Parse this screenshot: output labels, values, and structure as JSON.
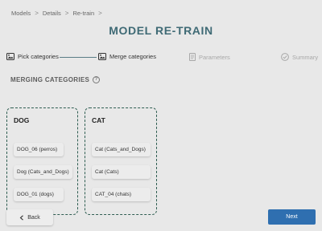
{
  "breadcrumb": {
    "items": [
      "Models",
      "Details",
      "Re-train"
    ],
    "separator": ">"
  },
  "page_title": "MODEL RE-TRAIN",
  "stepper": {
    "steps": [
      {
        "label": "Pick categories",
        "icon": "image-icon",
        "state": "active"
      },
      {
        "label": "Merge categories",
        "icon": "image-icon",
        "state": "active"
      },
      {
        "label": "Parameters",
        "icon": "document-icon",
        "state": "inactive"
      },
      {
        "label": "Summary",
        "icon": "check-circle-icon",
        "state": "inactive"
      }
    ]
  },
  "section": {
    "title": "MERGING CATEGORIES",
    "help_icon": "?"
  },
  "categories": [
    {
      "name": "DOG",
      "items": [
        "DOG_06 (perros)",
        "Dog (Cats_and_Dogs)",
        "DOG_01 (dogs)"
      ]
    },
    {
      "name": "CAT",
      "items": [
        "Cat (Cats_and_Dogs)",
        "Cat (Cats)",
        "CAT_04 (chats)"
      ]
    }
  ],
  "buttons": {
    "back": "Back",
    "next": "Next"
  },
  "colors": {
    "title": "#3f6a75",
    "dashed_border": "#2f5e52",
    "primary": "#2f6fb0",
    "background": "#e8e8e8"
  }
}
